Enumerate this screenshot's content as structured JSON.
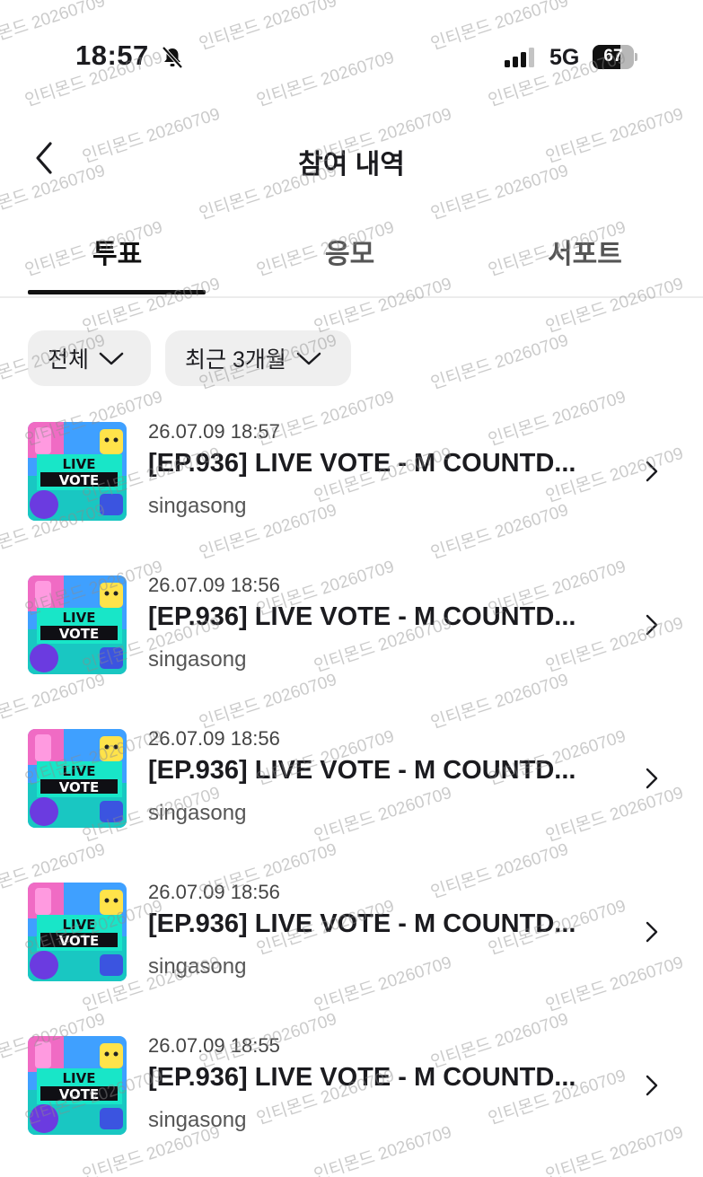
{
  "status_bar": {
    "time": "18:57",
    "network": "5G",
    "battery": "67",
    "battery_level": 0.67
  },
  "header": {
    "title": "참여 내역",
    "back_icon": "chevron-left-icon"
  },
  "tabs": [
    {
      "label": "투표",
      "active": true
    },
    {
      "label": "응모",
      "active": false
    },
    {
      "label": "서포트",
      "active": false
    }
  ],
  "filters": {
    "category": "전체",
    "period": "최근 3개월"
  },
  "items": [
    {
      "date": "26.07.09 18:57",
      "title": "[EP.936] LIVE VOTE - M COUNTD...",
      "artist": "singasong",
      "thumb_label_1": "LIVE",
      "thumb_label_2": "VOTE"
    },
    {
      "date": "26.07.09 18:56",
      "title": "[EP.936] LIVE VOTE - M COUNTD...",
      "artist": "singasong",
      "thumb_label_1": "LIVE",
      "thumb_label_2": "VOTE"
    },
    {
      "date": "26.07.09 18:56",
      "title": "[EP.936] LIVE VOTE - M COUNTD...",
      "artist": "singasong",
      "thumb_label_1": "LIVE",
      "thumb_label_2": "VOTE"
    },
    {
      "date": "26.07.09 18:56",
      "title": "[EP.936] LIVE VOTE - M COUNTD...",
      "artist": "singasong",
      "thumb_label_1": "LIVE",
      "thumb_label_2": "VOTE"
    },
    {
      "date": "26.07.09 18:55",
      "title": "[EP.936] LIVE VOTE - M COUNTD...",
      "artist": "singasong",
      "thumb_label_1": "LIVE",
      "thumb_label_2": "VOTE"
    }
  ],
  "watermark": "인티몬드 20260709",
  "colors": {
    "text": "#1b1b1f",
    "filter_bg": "#efefef",
    "thumb_teal": "#19c7c2",
    "thumb_blue": "#3b54e0",
    "thumb_pink": "#f06bc4",
    "thumb_yellow": "#ffe34a"
  }
}
